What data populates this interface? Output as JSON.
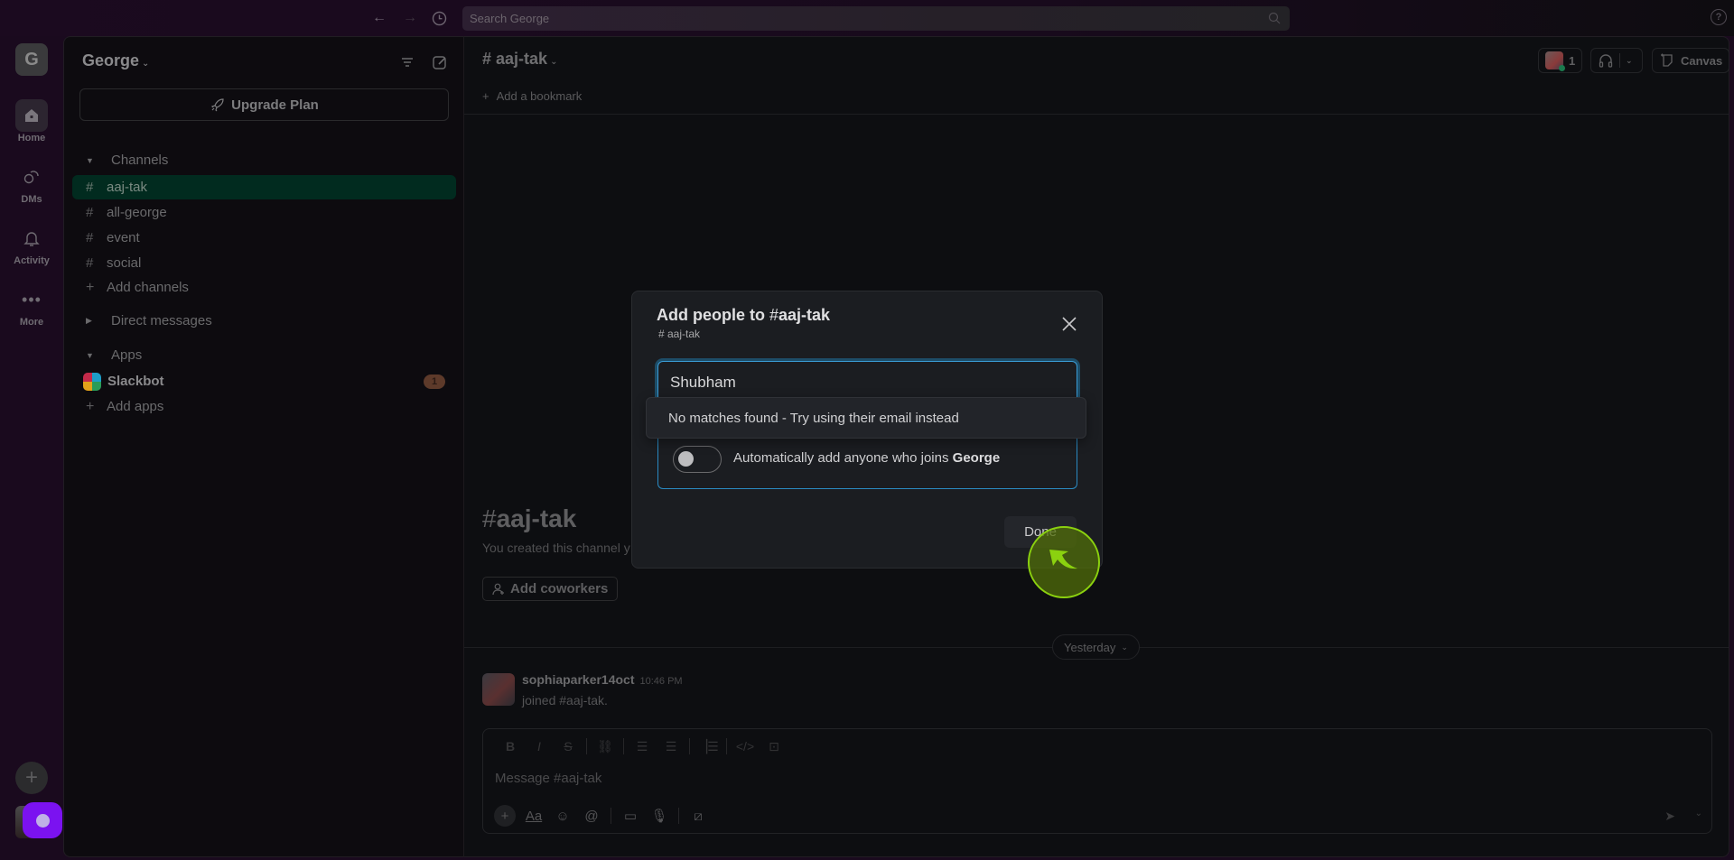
{
  "topbar": {
    "search_placeholder": "Search George",
    "icons": [
      "back-arrow-icon",
      "forward-arrow-icon",
      "history-clock-icon",
      "search-icon",
      "help-icon"
    ]
  },
  "rail": {
    "workspace_initial": "G",
    "items": [
      {
        "label": "Home",
        "icon": "home-icon",
        "active": true
      },
      {
        "label": "DMs",
        "icon": "dms-icon",
        "active": false
      },
      {
        "label": "Activity",
        "icon": "bell-icon",
        "active": false
      },
      {
        "label": "More",
        "icon": "more-dots-icon",
        "active": false
      }
    ],
    "recording_color": "#7b12f0"
  },
  "sidebar": {
    "workspace_name": "George",
    "upgrade_label": "Upgrade Plan",
    "channels_header": "Channels",
    "channels": [
      {
        "name": "aaj-tak",
        "active": true
      },
      {
        "name": "all-george",
        "active": false
      },
      {
        "name": "event",
        "active": false
      },
      {
        "name": "social",
        "active": false
      }
    ],
    "add_channels": "Add channels",
    "dm_header": "Direct messages",
    "apps_header": "Apps",
    "apps": [
      {
        "name": "Slackbot",
        "badge": "1"
      }
    ],
    "add_apps": "Add apps"
  },
  "channel": {
    "hash": "#",
    "name": "aaj-tak",
    "add_bookmark": "Add a bookmark",
    "member_count": "1",
    "canvas_label": "Canvas",
    "intro_title": "aaj-tak",
    "intro_sub": "You created this channel y",
    "add_coworkers": "Add coworkers",
    "day_divider": "Yesterday",
    "messages": [
      {
        "author": "sophiaparker14oct",
        "time": "10:46 PM",
        "text": "joined #aaj-tak."
      }
    ],
    "composer_placeholder": "Message #aaj-tak"
  },
  "modal": {
    "title_prefix": "Add people to",
    "title_hash": "#",
    "title_channel": "aaj-tak",
    "subtitle": "# aaj-tak",
    "input_value": "Shubham",
    "dropdown_text": "No matches found - Try using their email instead",
    "auto_add_text": "Automatically add anyone who joins",
    "auto_add_workspace": "George",
    "auto_add_enabled": false,
    "done_label": "Done"
  }
}
